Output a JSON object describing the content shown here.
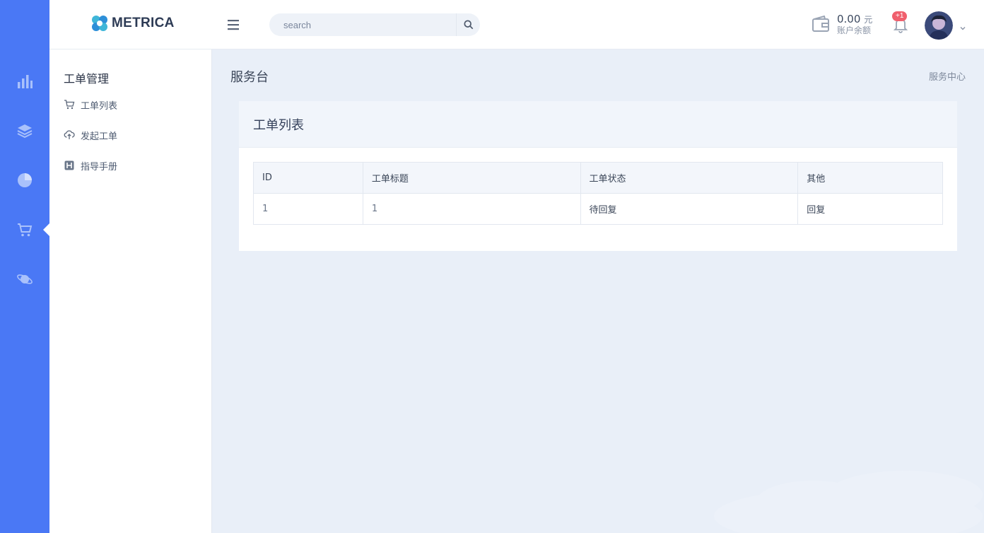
{
  "brand": {
    "name": "METRICA"
  },
  "rail": {
    "items": [
      {
        "icon": "bar-chart-icon"
      },
      {
        "icon": "layers-icon"
      },
      {
        "icon": "pie-chart-icon"
      },
      {
        "icon": "cart-icon",
        "active": true
      },
      {
        "icon": "planet-icon"
      }
    ]
  },
  "search": {
    "placeholder": "search"
  },
  "account": {
    "balance": "0.00",
    "unit": "元",
    "label": "账户余额"
  },
  "notifications": {
    "badge": "+1"
  },
  "subnav": {
    "title": "工单管理",
    "items": [
      {
        "label": "工单列表",
        "icon": "cart-icon"
      },
      {
        "label": "发起工单",
        "icon": "cloud-upload-icon"
      },
      {
        "label": "指导手册",
        "icon": "manual-icon"
      }
    ]
  },
  "page": {
    "title": "服务台",
    "breadcrumb": "服务中心"
  },
  "card": {
    "title": "工单列表"
  },
  "table": {
    "headers": [
      "ID",
      "工单标题",
      "工单状态",
      "其他"
    ],
    "rows": [
      {
        "id": "1",
        "title": "1",
        "status": "待回复",
        "action": "回复"
      }
    ]
  },
  "colors": {
    "rail": "#4a78f5",
    "background": "#e9eff8",
    "badge": "#f05f6d"
  }
}
